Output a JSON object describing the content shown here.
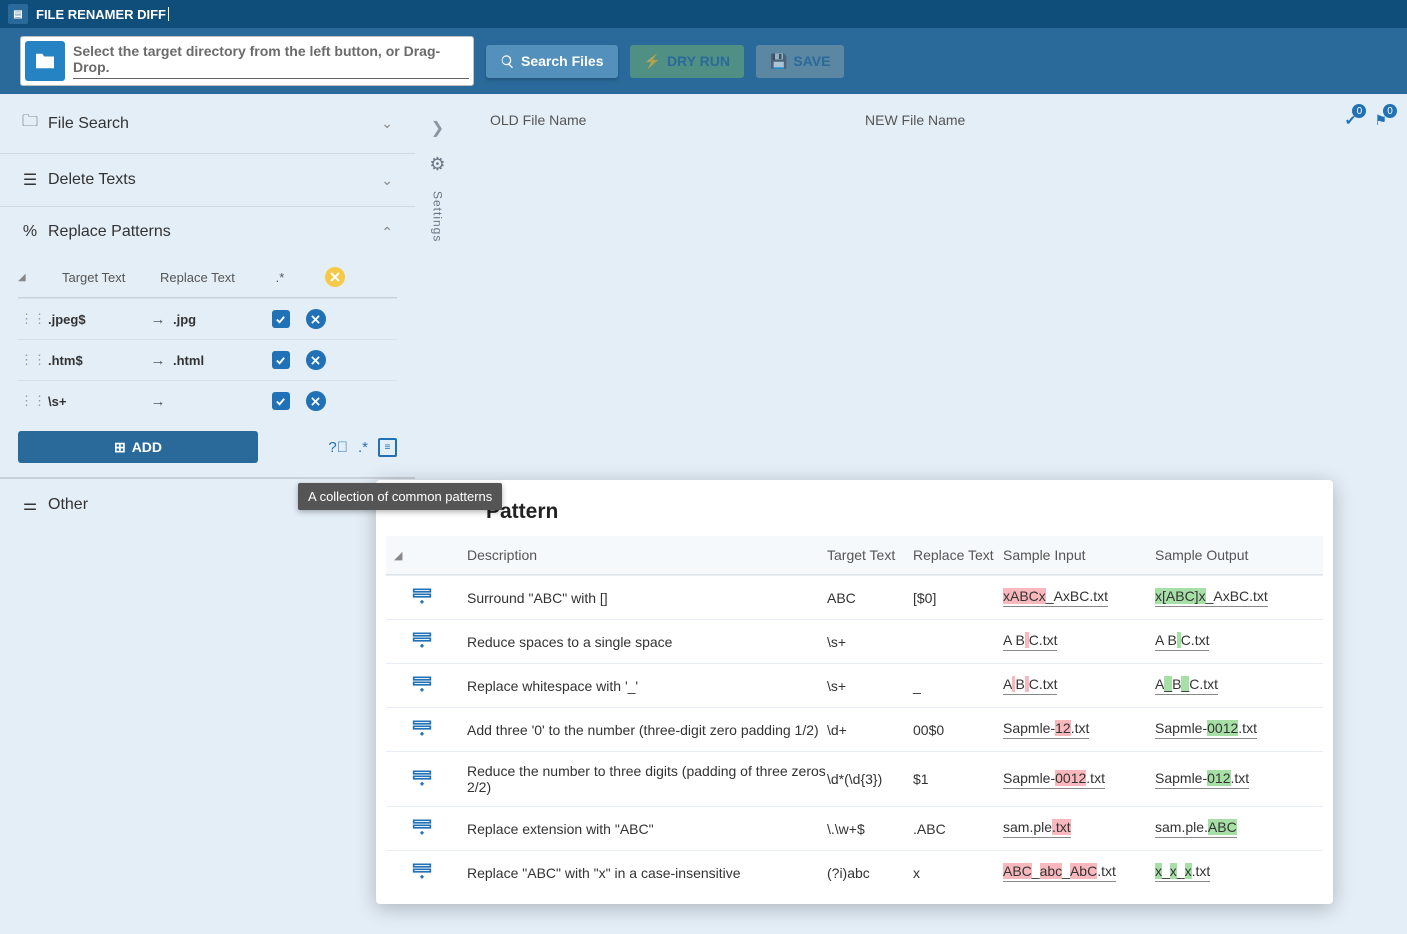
{
  "app": {
    "title": "FILE RENAMER DIFF"
  },
  "toolbar": {
    "directory_placeholder": "Select the target directory from the left button, or Drag-Drop.",
    "search": "Search Files",
    "dry_run": "DRY RUN",
    "save": "SAVE"
  },
  "sidebar": {
    "file_search": "File Search",
    "delete_texts": "Delete Texts",
    "replace_patterns": "Replace Patterns",
    "other": "Other"
  },
  "patterns": {
    "headers": {
      "target": "Target Text",
      "replace": "Replace Text"
    },
    "rows": [
      {
        "target": ".jpeg$",
        "replace": ".jpg"
      },
      {
        "target": ".htm$",
        "replace": ".html"
      },
      {
        "target": "\\s+",
        "replace": ""
      }
    ],
    "add": "ADD"
  },
  "files": {
    "old": "OLD File Name",
    "new": "NEW File Name",
    "check_count": "0",
    "conflict_count": "0"
  },
  "settings_label": "Settings",
  "tooltip": "A collection of common patterns",
  "popup": {
    "title": "Pattern",
    "headers": {
      "desc": "Description",
      "target": "Target Text",
      "replace": "Replace Text",
      "input": "Sample Input",
      "output": "Sample Output"
    },
    "rows": [
      {
        "desc": "Surround \"ABC\" with []",
        "target": "ABC",
        "replace": "[$0]",
        "in": [
          [
            "hl-red",
            "xABCx"
          ],
          [
            "",
            "_AxBC.txt"
          ]
        ],
        "out": [
          [
            "hl-green",
            "x[ABC]x"
          ],
          [
            "",
            "_AxBC.txt"
          ]
        ]
      },
      {
        "desc": "Reduce spaces to a single space",
        "target": "\\s+",
        "replace": "",
        "in": [
          [
            "",
            "A B"
          ],
          [
            "hl-red",
            "   "
          ],
          [
            "",
            "C.txt"
          ]
        ],
        "out": [
          [
            "",
            "A B"
          ],
          [
            "hl-green",
            " "
          ],
          [
            "",
            "C.txt"
          ]
        ]
      },
      {
        "desc": "Replace whitespace with '_'",
        "target": "\\s+",
        "replace": "_",
        "in": [
          [
            "",
            "A"
          ],
          [
            "hl-red",
            " "
          ],
          [
            "",
            "B"
          ],
          [
            "hl-red",
            "   "
          ],
          [
            "",
            "C.txt"
          ]
        ],
        "out": [
          [
            "",
            "A"
          ],
          [
            "hl-green",
            "_"
          ],
          [
            "",
            "B"
          ],
          [
            "hl-green",
            "_"
          ],
          [
            "",
            "C.txt"
          ]
        ]
      },
      {
        "desc": "Add three '0' to the number (three-digit zero padding 1/2)",
        "target": "\\d+",
        "replace": "00$0",
        "in": [
          [
            "",
            "Sapmle-"
          ],
          [
            "hl-red",
            "12"
          ],
          [
            "",
            ".txt"
          ]
        ],
        "out": [
          [
            "",
            "Sapmle-"
          ],
          [
            "hl-green",
            "0012"
          ],
          [
            "",
            ".txt"
          ]
        ]
      },
      {
        "desc": "Reduce the number to three digits (padding of three zeros 2/2)",
        "target": "\\d*(\\d{3})",
        "replace": "$1",
        "in": [
          [
            "",
            "Sapmle-"
          ],
          [
            "hl-red",
            "0012"
          ],
          [
            "",
            ".txt"
          ]
        ],
        "out": [
          [
            "",
            "Sapmle-"
          ],
          [
            "hl-green",
            "012"
          ],
          [
            "",
            ".txt"
          ]
        ]
      },
      {
        "desc": "Replace extension with \"ABC\"",
        "target": "\\.\\w+$",
        "replace": ".ABC",
        "in": [
          [
            "",
            "sam.ple"
          ],
          [
            "hl-red",
            ".txt"
          ]
        ],
        "out": [
          [
            "",
            "sam.ple."
          ],
          [
            "hl-green",
            "ABC"
          ]
        ]
      },
      {
        "desc": "Replace \"ABC\" with \"x\" in a case-insensitive",
        "target": "(?i)abc",
        "replace": "x",
        "in": [
          [
            "hl-red",
            "ABC"
          ],
          [
            "",
            "_"
          ],
          [
            "hl-red",
            "abc"
          ],
          [
            "",
            "_"
          ],
          [
            "hl-red",
            "AbC"
          ],
          [
            "",
            ".txt"
          ]
        ],
        "out": [
          [
            "hl-green",
            "x"
          ],
          [
            "",
            "_"
          ],
          [
            "hl-green",
            "x"
          ],
          [
            "",
            "_"
          ],
          [
            "hl-green",
            "x"
          ],
          [
            "",
            ".txt"
          ]
        ]
      }
    ]
  }
}
